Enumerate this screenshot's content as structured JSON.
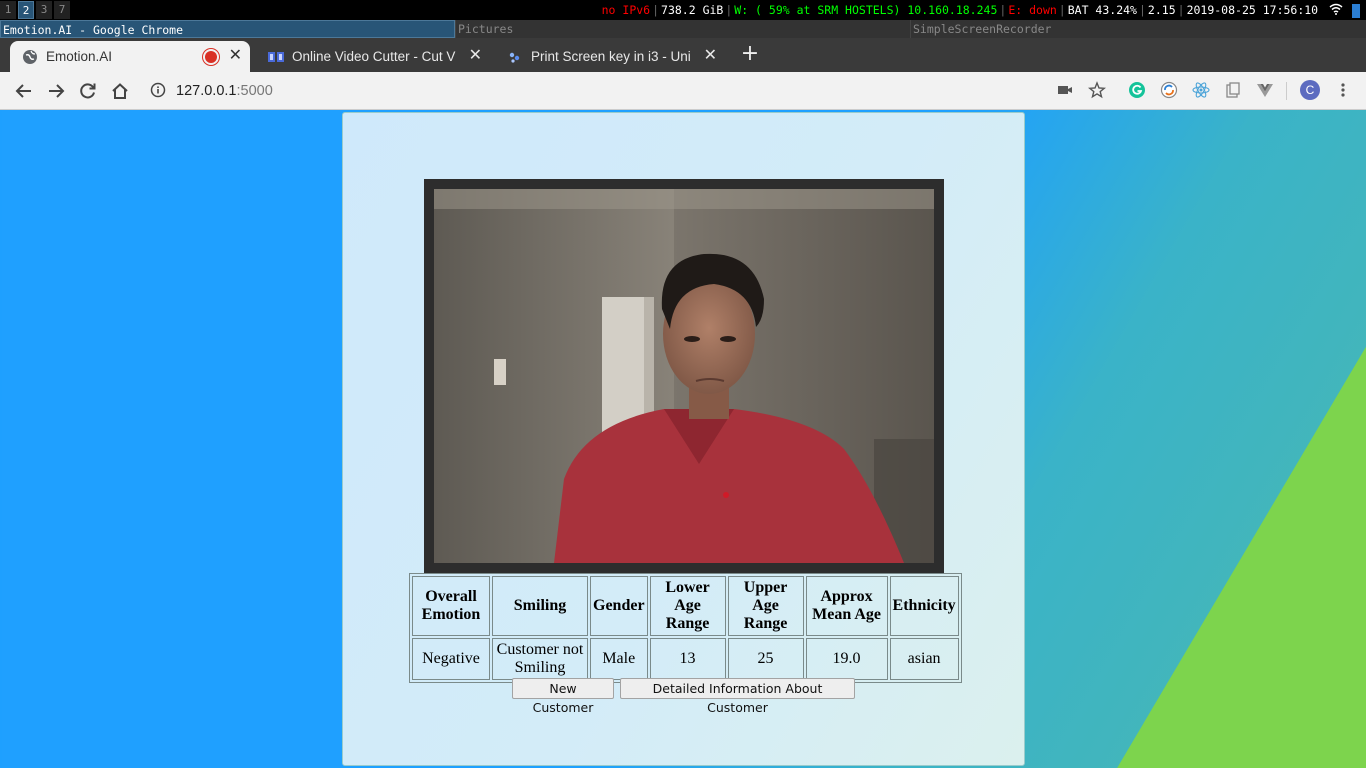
{
  "i3bar": {
    "workspaces": [
      "1",
      "2",
      "3",
      "7"
    ],
    "active_workspace": "2",
    "status": {
      "ipv6": "no IPv6",
      "disk": "738.2 GiB",
      "wifi": "W: ( 59% at SRM HOSTELS) 10.160.18.245",
      "ethernet": "E: down",
      "battery": "BAT 43.24%",
      "load": "2.15",
      "datetime": "2019-08-25 17:56:10"
    }
  },
  "titlebars": {
    "active": "Emotion.AI - Google Chrome",
    "middle": "Pictures",
    "right": "SimpleScreenRecorder"
  },
  "browser": {
    "tabs": [
      {
        "title": "Emotion.AI",
        "active": true,
        "recording": true
      },
      {
        "title": "Online Video Cutter - Cut V",
        "active": false
      },
      {
        "title": "Print Screen key in i3 - Uni",
        "active": false
      }
    ],
    "new_tab": "+",
    "url_host": "127.0.0.1",
    "url_port": ":5000",
    "profile_initial": "C"
  },
  "results": {
    "headers": [
      "Overall Emotion",
      "Smiling",
      "Gender",
      "Lower Age Range",
      "Upper Age Range",
      "Approx Mean Age",
      "Ethnicity"
    ],
    "row": [
      "Negative",
      "Customer not Smiling",
      "Male",
      "13",
      "25",
      "19.0",
      "asian"
    ]
  },
  "buttons": {
    "new_customer": "New Customer",
    "details": "Detailed Information About Customer"
  },
  "colors": {
    "page_blue": "#1ea0ff",
    "page_green": "#7dd44d",
    "i3_active": "#285577"
  }
}
